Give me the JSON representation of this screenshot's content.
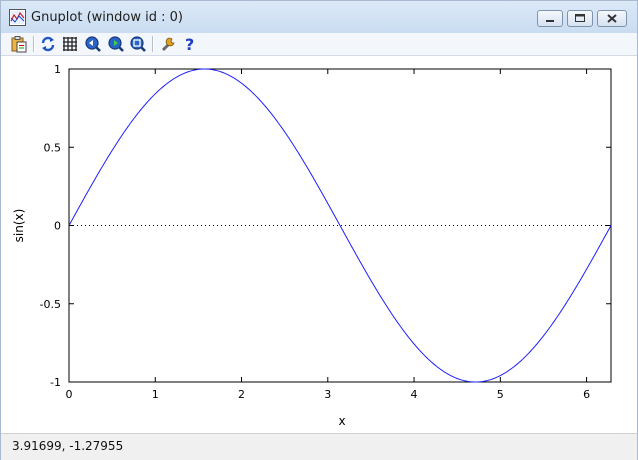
{
  "window": {
    "title": "Gnuplot (window id : 0)"
  },
  "title_buttons": [
    {
      "icon": "minimize-icon"
    },
    {
      "icon": "maximize-icon"
    },
    {
      "icon": "close-icon"
    }
  ],
  "toolbar": {
    "buttons": [
      {
        "icon": "clipboard-icon"
      },
      {
        "icon": "replot-icon"
      },
      {
        "icon": "grid-icon"
      },
      {
        "icon": "zoom-previous-icon"
      },
      {
        "icon": "zoom-next-icon"
      },
      {
        "icon": "unzoom-icon"
      },
      {
        "icon": "options-wrench-icon"
      },
      {
        "icon": "help-icon"
      }
    ]
  },
  "colors": {
    "curve": "#1f1fff",
    "title_bar": "#c9dcf1"
  },
  "status": {
    "coordinates": "3.91699, -1.27955"
  },
  "chart_data": {
    "type": "line",
    "title": "",
    "xlabel": "x",
    "ylabel": "sin(x)",
    "xlim": [
      0,
      6.283185
    ],
    "ylim": [
      -1,
      1
    ],
    "x_ticks": [
      "0",
      "1",
      "2",
      "3",
      "4",
      "5",
      "6"
    ],
    "y_ticks": [
      "-1",
      "-0.5",
      "0",
      "0.5",
      "1"
    ],
    "grid": false,
    "zero_axis": "dotted",
    "legend": "none",
    "series": [
      {
        "function": "sin(x)",
        "x": [
          0,
          0.25,
          0.5,
          0.75,
          1,
          1.25,
          1.5,
          1.5708,
          1.75,
          2,
          2.25,
          2.5,
          2.75,
          3,
          3.1416,
          3.25,
          3.5,
          3.75,
          4,
          4.25,
          4.5,
          4.7124,
          4.75,
          5,
          5.25,
          5.5,
          5.75,
          6,
          6.2832
        ],
        "y": [
          0,
          0.2474,
          0.4794,
          0.6816,
          0.8415,
          0.949,
          0.9975,
          1,
          0.984,
          0.9093,
          0.7781,
          0.5985,
          0.3817,
          0.1411,
          0,
          -0.1082,
          -0.3508,
          -0.5716,
          -0.7568,
          -0.895,
          -0.9775,
          -1,
          -0.9993,
          -0.9589,
          -0.8589,
          -0.7055,
          -0.5082,
          -0.2794,
          0
        ]
      }
    ]
  }
}
